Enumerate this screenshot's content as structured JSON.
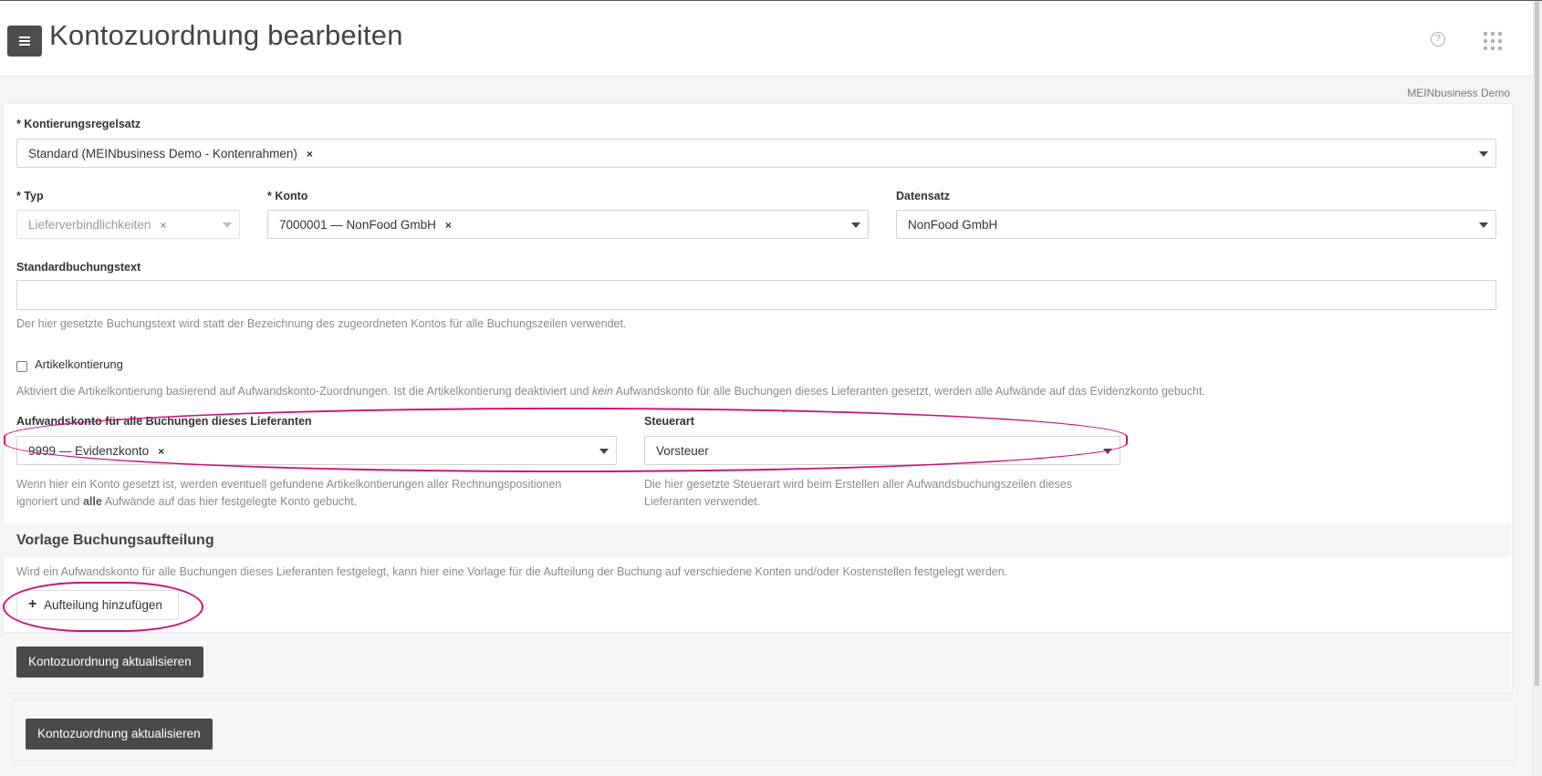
{
  "header": {
    "title": "Kontozuordnung bearbeiten",
    "help_icon": "question-circle-icon",
    "apps_icon": "grid-dots-icon",
    "menu_icon": "hamburger-icon"
  },
  "company": "MEINbusiness Demo",
  "form": {
    "kontierungsregelsatz": {
      "label": "* Kontierungsregelsatz",
      "value": "Standard (MEINbusiness Demo - Kontenrahmen)",
      "clear": "×"
    },
    "typ": {
      "label": "* Typ",
      "value": "Lieferverbindlichkeiten",
      "clear": "×",
      "disabled": true
    },
    "konto": {
      "label": "* Konto",
      "value": "7000001 — NonFood GmbH",
      "clear": "×"
    },
    "datensatz": {
      "label": "Datensatz",
      "value": "NonFood GmbH"
    },
    "standardbuchungstext": {
      "label": "Standardbuchungstext",
      "value": "",
      "help": "Der hier gesetzte Buchungstext wird statt der Bezeichnung des zugeordneten Kontos für alle Buchungszeilen verwendet."
    },
    "artikelkontierung": {
      "label": "Artikelkontierung",
      "checked": false,
      "help_before": "Aktiviert die Artikelkontierung basierend auf Aufwandskonto-Zuordnungen. Ist die Artikelkontierung deaktiviert und ",
      "help_em": "kein",
      "help_after": " Aufwandskonto für alle Buchungen dieses Lieferanten gesetzt, werden alle Aufwände auf das Evidenzkonto gebucht."
    },
    "aufwandskonto": {
      "label": "Aufwandskonto für alle Buchungen dieses Lieferanten",
      "value": "9999 — Evidenzkonto",
      "clear": "×",
      "help_line1": "Wenn hier ein Konto gesetzt ist, werden eventuell gefundene Artikelkontierungen aller Rechnungspositionen",
      "help_line2_before": "ignoriert und ",
      "help_line2_bold": "alle",
      "help_line2_after": " Aufwände auf das hier festgelegte Konto gebucht."
    },
    "steuerart": {
      "label": "Steuerart",
      "value": "Vorsteuer",
      "help_line1": "Die hier gesetzte Steuerart wird beim Erstellen aller Aufwandsbuchungszeilen dieses",
      "help_line2": "Lieferanten verwendet."
    }
  },
  "vorlage": {
    "title": "Vorlage Buchungsaufteilung",
    "help": "Wird ein Aufwandskonto für alle Buchungen dieses Lieferanten festgelegt, kann hier eine Vorlage für die Aufteilung der Buchung auf verschiedene Konten und/oder Kostenstellen festgelegt werden.",
    "add_button": "Aufteilung hinzufügen",
    "add_icon": "plus-icon"
  },
  "actions": {
    "submit": "Kontozuordnung aktualisieren",
    "submit_bottom": "Kontozuordnung aktualisieren"
  },
  "colors": {
    "annotation": "#cc1177",
    "dark_button": "#4a4a4a"
  }
}
